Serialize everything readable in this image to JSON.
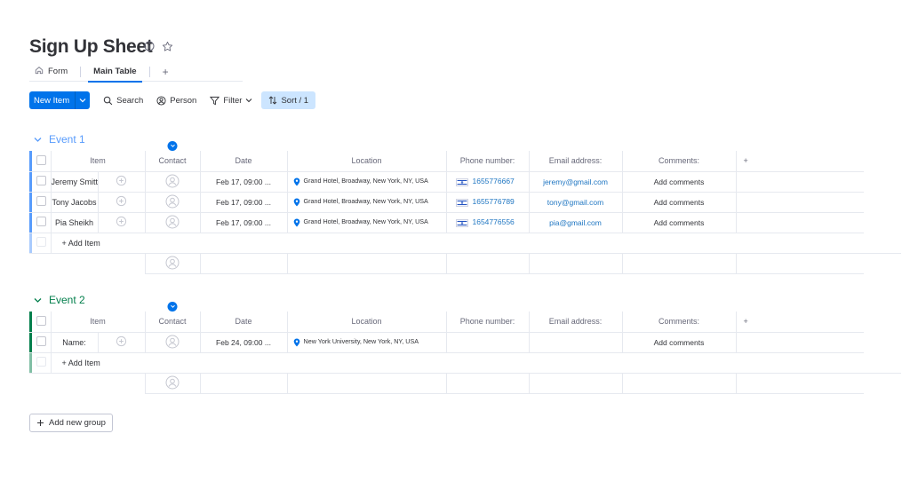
{
  "board": {
    "title": "Sign Up Sheet",
    "tabs": [
      {
        "label": "Form",
        "icon": "home-icon"
      },
      {
        "label": "Main Table",
        "active": true
      }
    ],
    "tab_add": "+"
  },
  "toolbar": {
    "new_item": "New Item",
    "search": "Search",
    "person": "Person",
    "filter": "Filter",
    "sort": "Sort / 1"
  },
  "columns": {
    "item": "Item",
    "contact": "Contact",
    "date": "Date",
    "location": "Location",
    "phone": "Phone number:",
    "email": "Email address:",
    "comments": "Comments:",
    "add_column": "+"
  },
  "groups": [
    {
      "name": "Event 1",
      "color": "#579bfc",
      "rows": [
        {
          "item": "Jeremy Smitt",
          "date": "Feb 17, 09:00 ...",
          "location": "Grand Hotel, Broadway, New York, NY, USA",
          "phone": "1655776667",
          "email": "jeremy@gmail.com",
          "comments": "Add comments"
        },
        {
          "item": "Tony Jacobs",
          "date": "Feb 17, 09:00 ...",
          "location": "Grand Hotel, Broadway, New York, NY, USA",
          "phone": "1655776789",
          "email": "tony@gmail.com",
          "comments": "Add comments"
        },
        {
          "item": "Pia Sheikh",
          "date": "Feb 17, 09:00 ...",
          "location": "Grand Hotel, Broadway, New York, NY, USA",
          "phone": "1654776556",
          "email": "pia@gmail.com",
          "comments": "Add comments"
        }
      ],
      "add_item": "+ Add Item"
    },
    {
      "name": "Event 2",
      "color": "#037f4c",
      "rows": [
        {
          "item": "Name:",
          "date": "Feb 24, 09:00 ...",
          "location": "New York University, New York, NY, USA",
          "phone": "",
          "email": "",
          "comments": "Add comments"
        }
      ],
      "add_item": "+ Add Item"
    }
  ],
  "add_group": "Add new group",
  "colors": {
    "primary": "#0073ea",
    "group1": "#579bfc",
    "group2": "#037f4c",
    "link": "#1f76c2"
  }
}
